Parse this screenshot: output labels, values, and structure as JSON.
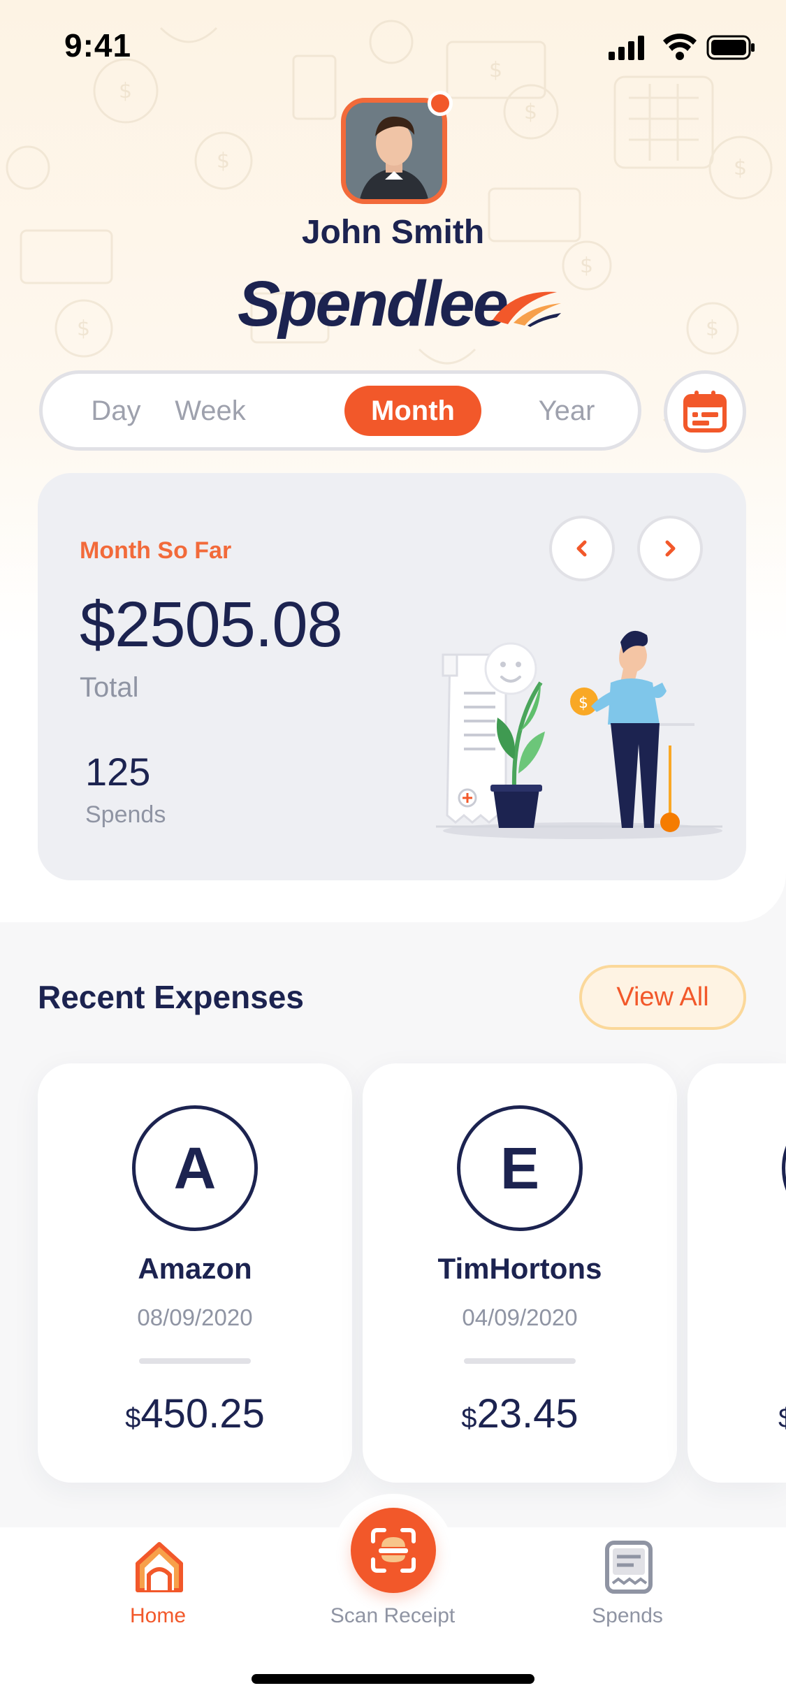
{
  "status_bar": {
    "time": "9:41"
  },
  "profile": {
    "name": "John Smith"
  },
  "brand": {
    "name": "Spendlee"
  },
  "period_tabs": [
    {
      "label": "Day",
      "active": false
    },
    {
      "label": "Week",
      "active": false
    },
    {
      "label": "Month",
      "active": true
    },
    {
      "label": "Year",
      "active": false
    }
  ],
  "summary": {
    "period_label": "Month So Far",
    "total_amount": "$2505.08",
    "total_label": "Total",
    "spends_count": "125",
    "spends_label": "Spends"
  },
  "recent": {
    "title": "Recent Expenses",
    "view_all_label": "View All",
    "items": [
      {
        "initial": "A",
        "name": "Amazon",
        "date": "08/09/2020",
        "currency": "$",
        "amount": "450.25"
      },
      {
        "initial": "E",
        "name": "TimHortons",
        "date": "04/09/2020",
        "currency": "$",
        "amount": "23.45"
      },
      {
        "initial": "",
        "name": "",
        "date": "",
        "currency": "$",
        "amount": ""
      }
    ]
  },
  "tabbar": {
    "home_label": "Home",
    "scan_label": "Scan Receipt",
    "spends_label": "Spends"
  },
  "colors": {
    "accent": "#f2582a",
    "navy": "#1c2350",
    "muted": "#8f94a3",
    "card_bg": "#eeeff3",
    "view_all_bg": "#fef3e3"
  },
  "icons": {
    "calendar": "calendar-icon",
    "prev": "chevron-left-icon",
    "next": "chevron-right-icon",
    "home": "home-icon",
    "scan": "scan-receipt-icon",
    "spends": "receipt-list-icon"
  }
}
